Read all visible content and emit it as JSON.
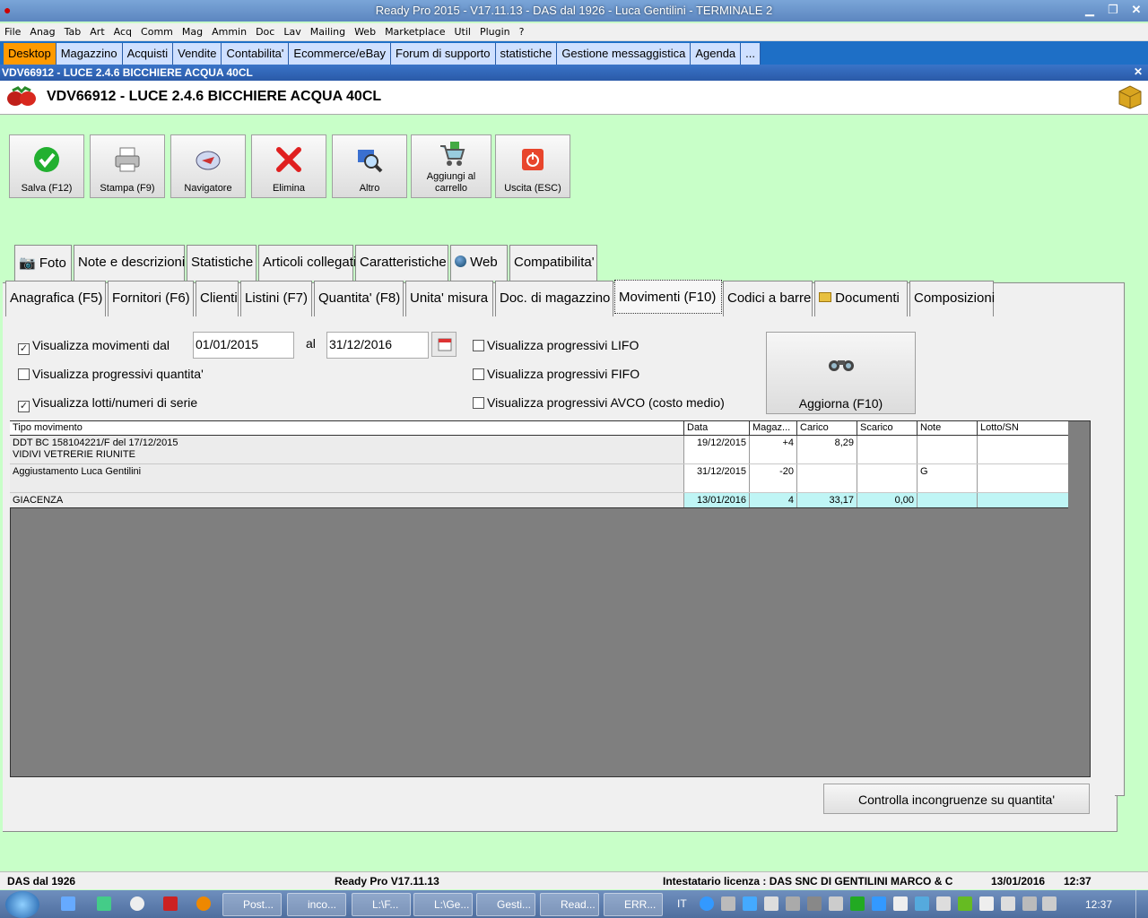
{
  "window": {
    "title": "Ready Pro 2015 - V17.11.13 - DAS dal 1926 - Luca Gentilini - TERMINALE 2"
  },
  "menu": [
    "File",
    "Anag",
    "Tab",
    "Art",
    "Acq",
    "Comm",
    "Mag",
    "Ammin",
    "Doc",
    "Lav",
    "Mailing",
    "Web",
    "Marketplace",
    "Util",
    "Plugin",
    "?"
  ],
  "modules": [
    "Desktop",
    "Magazzino",
    "Acquisti",
    "Vendite",
    "Contabilita'",
    "Ecommerce/eBay",
    "Forum di supporto",
    "statistiche",
    "Gestione messaggistica",
    "Agenda",
    "..."
  ],
  "doc": {
    "strip": "VDV66912 - LUCE 2.4.6 BICCHIERE ACQUA 40CL",
    "title": "VDV66912 - LUCE 2.4.6 BICCHIERE ACQUA 40CL"
  },
  "toolbar": {
    "save": "Salva (F12)",
    "print": "Stampa (F9)",
    "nav": "Navigatore",
    "delete": "Elimina",
    "more": "Altro",
    "cart1": "Aggiungi al",
    "cart2": "carrello",
    "exit": "Uscita (ESC)"
  },
  "tabs_top": [
    "Foto",
    "Note e descrizioni",
    "Statistiche",
    "Articoli collegati",
    "Caratteristiche",
    "Web",
    "Compatibilita'"
  ],
  "tabs_bottom": [
    "Anagrafica (F5)",
    "Fornitori (F6)",
    "Clienti",
    "Listini (F7)",
    "Quantita' (F8)",
    "Unita' misura",
    "Doc. di magazzino",
    "Movimenti (F10)",
    "Codici a barre",
    "Documenti",
    "Composizioni"
  ],
  "form": {
    "show_moves": "Visualizza movimenti dal",
    "date_from": "01/01/2015",
    "al": "al",
    "date_to": "31/12/2016",
    "prog_qty": "Visualizza progressivi quantita'",
    "lots": "Visualizza lotti/numeri di serie",
    "lifo": "Visualizza progressivi LIFO",
    "fifo": "Visualizza progressivi FIFO",
    "avco": "Visualizza progressivi AVCO (costo medio)",
    "refresh": "Aggiorna (F10)",
    "check": "Controlla incongruenze su quantita'"
  },
  "grid": {
    "headers": [
      "Tipo movimento",
      "Data",
      "Magaz...",
      "Carico",
      "Scarico",
      "Note",
      "Lotto/SN"
    ],
    "rows": [
      {
        "tipo1": "DDT BC 158104221/F del 17/12/2015",
        "tipo2": "VIDIVI VETRERIE RIUNITE",
        "data": "19/12/2015",
        "mag": "+4",
        "carico": "8,29",
        "scarico": "",
        "note": "",
        "lotto": ""
      },
      {
        "tipo1": "Aggiustamento Luca Gentilini",
        "tipo2": "",
        "data": "31/12/2015",
        "mag": "-20",
        "carico": "",
        "scarico": "",
        "note": "G",
        "lotto": ""
      },
      {
        "tipo1": "GIACENZA",
        "tipo2": "",
        "data": "13/01/2016",
        "mag": "4",
        "carico": "33,17",
        "scarico": "0,00",
        "note": "",
        "lotto": ""
      }
    ]
  },
  "status": {
    "company": "DAS dal 1926",
    "version": "Ready Pro V17.11.13",
    "license": "Intestatario licenza : DAS SNC DI GENTILINI MARCO & C",
    "date": "13/01/2016",
    "time": "12:37"
  },
  "taskbar": {
    "items": [
      "Post...",
      "inco...",
      "L:\\F...",
      "L:\\Ge...",
      "Gesti...",
      "Read...",
      "ERR..."
    ],
    "lang": "IT",
    "clock": "12:37"
  }
}
